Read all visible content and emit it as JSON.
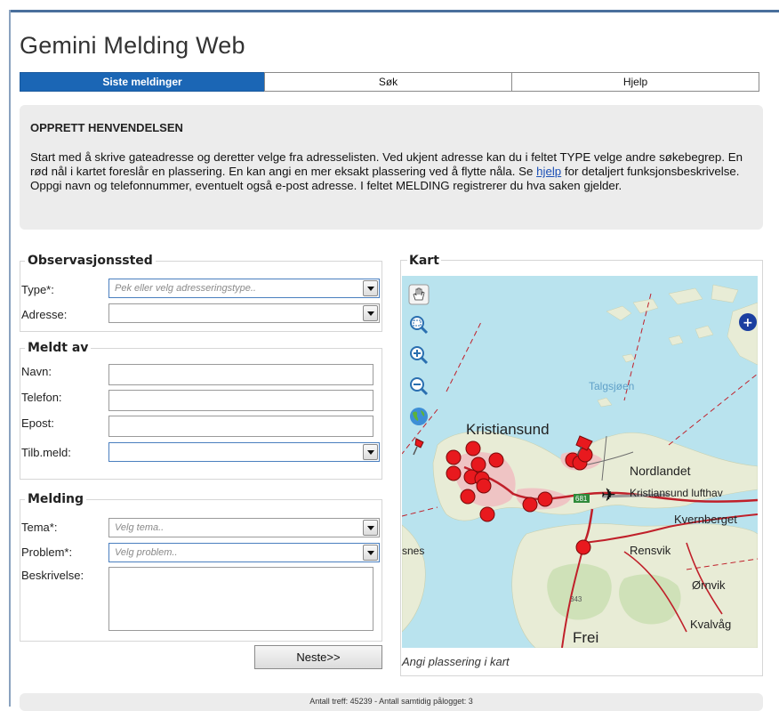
{
  "app": {
    "title": "Gemini Melding Web"
  },
  "tabs": [
    {
      "label": "Siste meldinger",
      "active": true
    },
    {
      "label": "Søk",
      "active": false
    },
    {
      "label": "Hjelp",
      "active": false
    }
  ],
  "intro": {
    "heading": "OPPRETT HENVENDELSEN",
    "text_before_link": "Start med å skrive gateadresse og deretter velge fra adresselisten. Ved ukjent adresse kan du i feltet TYPE velge andre søkebegrep. En rød nål i kartet foreslår en plassering. En kan angi en mer eksakt plassering ved å flytte nåla. Se ",
    "link": "hjelp",
    "text_after_link": " for detaljert funksjonsbeskrivelse. Oppgi navn og telefonnummer, eventuelt også e-post adresse. I feltet MELDING registrerer du hva saken gjelder."
  },
  "observasjonssted": {
    "legend": "Observasjonssted",
    "type_label": "Type*:",
    "type_placeholder": "Pek eller velg adresseringstype..",
    "address_label": "Adresse:",
    "address_value": ""
  },
  "meldt_av": {
    "legend": "Meldt av",
    "name_label": "Navn:",
    "phone_label": "Telefon:",
    "email_label": "Epost:",
    "feedback_label": "Tilb.meld:"
  },
  "melding": {
    "legend": "Melding",
    "theme_label": "Tema*:",
    "theme_placeholder": "Velg tema..",
    "problem_label": "Problem*:",
    "problem_placeholder": "Velg problem..",
    "description_label": "Beskrivelse:"
  },
  "actions": {
    "next_label": "Neste>>"
  },
  "map": {
    "legend": "Kart",
    "caption": "Angi plassering i kart",
    "places": {
      "talgsjoen": "Talgsjøen",
      "kristiansund": "Kristiansund",
      "nordlandet": "Nordlandet",
      "airport": "Kristiansund lufthav",
      "kvernberget": "Kvernberget",
      "rensvik": "Rensvik",
      "ornvik": "Ørnvik",
      "kvalvag": "Kvalvåg",
      "frei": "Frei",
      "snes": "snes",
      "road_681": "681",
      "elevation_343": "343"
    },
    "tools": [
      "pan-hand-icon",
      "zoom-box-icon",
      "zoom-in-icon",
      "zoom-out-icon",
      "globe-icon",
      "pushpin-icon"
    ],
    "colors": {
      "sea": "#b9e3ee",
      "land": "#e8ecd6",
      "town": "#efc4c4",
      "road": "#c0202a",
      "marker": "#e8191e"
    }
  },
  "footer": {
    "text": "Antall treff: 45239 - Antall samtidig pålogget: 3"
  }
}
